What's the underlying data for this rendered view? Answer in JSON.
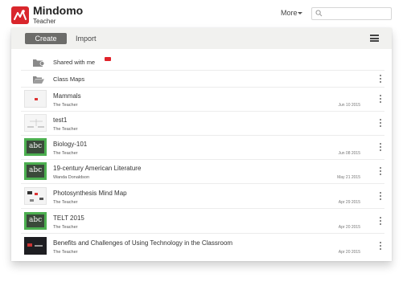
{
  "app": {
    "brand": "Mindomo",
    "edition": "Teacher",
    "more_label": "More",
    "search_placeholder": "",
    "logo_color": "#d9262c"
  },
  "toolbar": {
    "create_label": "Create",
    "import_label": "Import",
    "menu_icon": "hamburger-icon"
  },
  "folders": [
    {
      "label": "Shared with me",
      "icon": "shared-folder-icon",
      "has_badge": true,
      "badge_color": "#e0232a"
    },
    {
      "label": "Class Maps",
      "icon": "open-folder-icon",
      "has_badge": false
    }
  ],
  "maps": [
    {
      "title": "Mammals",
      "author": "The Teacher",
      "date": "Jun 10 2015",
      "thumb": "mindmap-light"
    },
    {
      "title": "test1",
      "author": "The Teacher",
      "date": "",
      "thumb": "mindmap-sketch"
    },
    {
      "title": "Biology-101",
      "author": "The Teacher",
      "date": "Jun 08 2015",
      "thumb": "abc-chalkboard"
    },
    {
      "title": "19-century American Literature",
      "author": "Wanda Donaldson",
      "date": "May 21 2015",
      "thumb": "abc-chalkboard"
    },
    {
      "title": "Photosynthesis Mind Map",
      "author": "The Teacher",
      "date": "Apr 29 2015",
      "thumb": "mindmap-color"
    },
    {
      "title": "TELT 2015",
      "author": "The Teacher",
      "date": "Apr 20 2015",
      "thumb": "abc-chalkboard"
    },
    {
      "title": "Benefits and Challenges of Using Technology in the Classroom",
      "author": "The Teacher",
      "date": "Apr 20 2015",
      "thumb": "dark-slide"
    }
  ]
}
